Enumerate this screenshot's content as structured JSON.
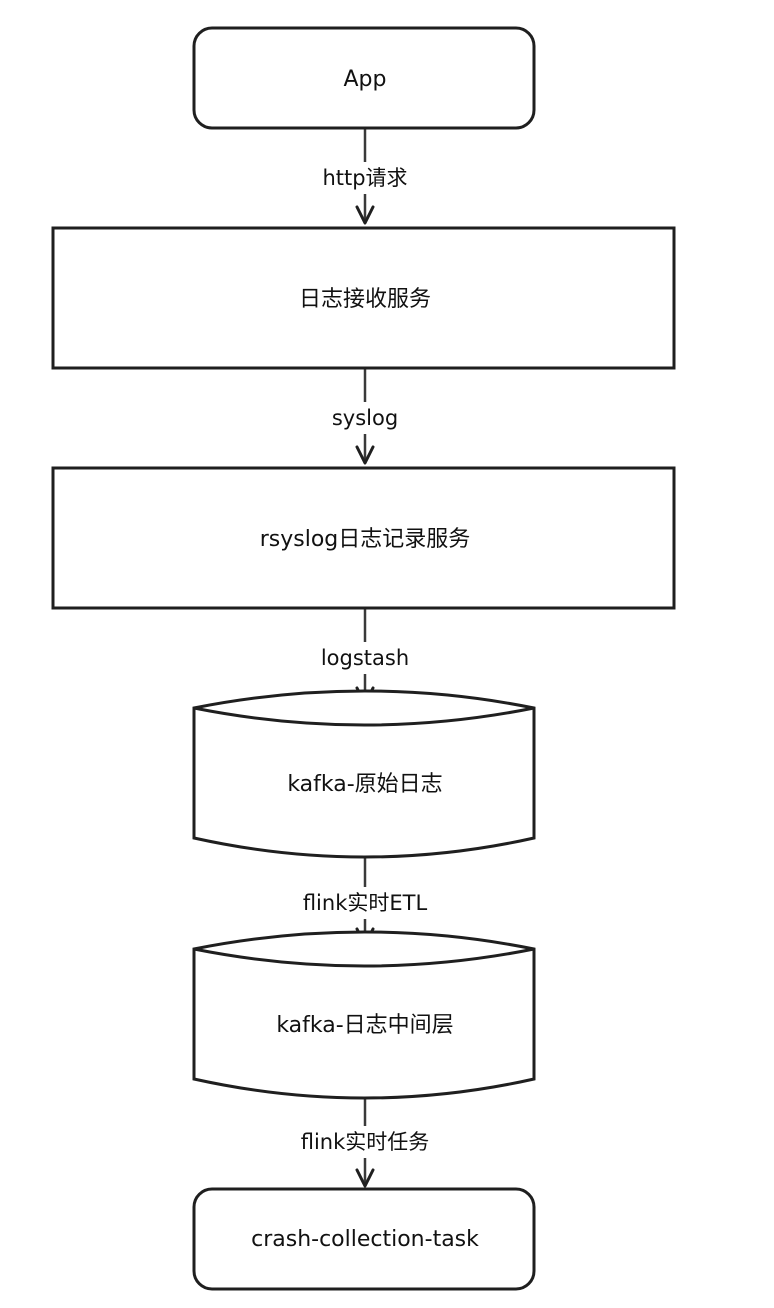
{
  "diagram": {
    "nodes": {
      "app": {
        "label": "App",
        "shape": "rounded-rectangle"
      },
      "log_receiver": {
        "label": "日志接收服务",
        "shape": "rectangle"
      },
      "rsyslog": {
        "label": "rsyslog日志记录服务",
        "shape": "rectangle"
      },
      "kafka_raw": {
        "label": "kafka-原始日志",
        "shape": "cylinder"
      },
      "kafka_middle": {
        "label": "kafka-日志中间层",
        "shape": "cylinder"
      },
      "crash_task": {
        "label": "crash-collection-task",
        "shape": "rounded-rectangle"
      }
    },
    "edges": {
      "http": {
        "label": "http请求",
        "from": "App",
        "to": "日志接收服务"
      },
      "syslog": {
        "label": "syslog",
        "from": "日志接收服务",
        "to": "rsyslog日志记录服务"
      },
      "logstash": {
        "label": "logstash",
        "from": "rsyslog日志记录服务",
        "to": "kafka-原始日志"
      },
      "flink_etl": {
        "label": "flink实时ETL",
        "from": "kafka-原始日志",
        "to": "kafka-日志中间层"
      },
      "flink_task": {
        "label": "flink实时任务",
        "from": "kafka-日志中间层",
        "to": "crash-collection-task"
      }
    },
    "colors": {
      "stroke": "#1f1f1f",
      "fill": "#ffffff",
      "text": "#111111"
    }
  }
}
